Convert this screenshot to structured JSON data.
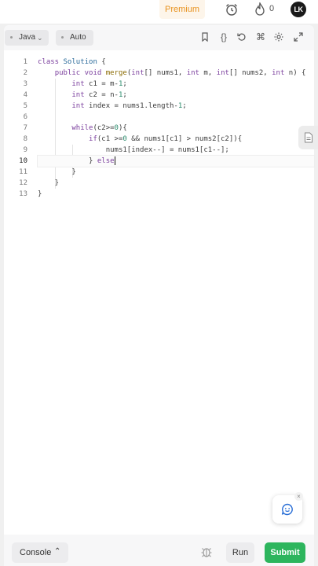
{
  "header": {
    "premium_label": "Premium",
    "streak_count": "0",
    "avatar_initials": "LK"
  },
  "toolbar": {
    "language": "Java",
    "mode": "Auto",
    "icons": [
      "bookmark-icon",
      "braces-icon",
      "reset-icon",
      "shortcut-icon",
      "settings-icon",
      "fullscreen-icon"
    ]
  },
  "editor": {
    "line_numbers": [
      "1",
      "2",
      "3",
      "4",
      "5",
      "6",
      "7",
      "8",
      "9",
      "10",
      "11",
      "12",
      "13"
    ],
    "current_line": 10
  },
  "footer": {
    "console_label": "Console",
    "run_label": "Run",
    "submit_label": "Submit"
  },
  "colors": {
    "premium": "#e8921e",
    "submit": "#2db55d",
    "keyword": "#7a3e9d",
    "number": "#2a8a6b"
  }
}
